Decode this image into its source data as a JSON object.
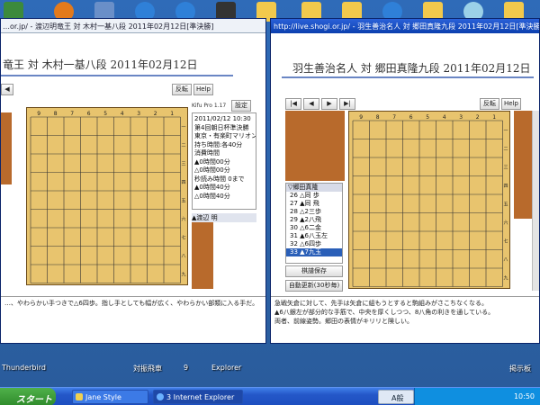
{
  "left_window": {
    "title": "…or.jp/ - 渡辺明竜王 対 木村一基八段 2011年02月12日[準決勝]",
    "heading": "竜王 対 木村一基八段  2011年02月12日",
    "buttons": {
      "reverse": "反転",
      "help": "Help",
      "settings": "設定"
    },
    "version": "Kifu Pro 1.17",
    "info_lines": [
      "2011/02/12 10:30",
      "第4回朝日杯準決勝",
      "東京・有楽町マリオン",
      "持ち時間:各40分",
      "消費時間",
      "▲0時間00分",
      "△0時間00分",
      "秒読み時間 0まで",
      "▲0時間40分",
      "△0時間40分"
    ],
    "player_gote": "▲渡辺 明",
    "comment": "…、やわらかい手つきで△6四歩。指し手としても幅が広く、やわらかい部類に入る手だ。"
  },
  "right_window": {
    "title": "http://live.shogi.or.jp/ - 羽生善治名人 対 郷田真隆九段 2011年02月12日[準決勝]",
    "heading": "羽生善治名人 対 郷田真隆九段  2011年02月12日",
    "buttons": {
      "reverse": "反転",
      "help": "Help"
    },
    "player": "▽郷田真隆",
    "moves": [
      "26 △同 歩",
      "27 ▲同 飛",
      "28 △2三歩",
      "29 ▲2八飛",
      "30 △6二金",
      "31 ▲6八玉左",
      "32 △6四歩",
      "33 ▲7九玉"
    ],
    "selected_move_index": 7,
    "save_button": "棋譜保存",
    "auto_update": "自動更新(30秒毎)",
    "comment_lines": [
      "急戦矢倉に対して、先手は矢倉に組もうとすると駒組みがさこちなくなる。",
      "▲6八銀左が部分的な手筋で、中央を厚くしつつ、8八角の利きを通している。",
      "両者、前線姿勢。郷田の表情がキリリと険しい。"
    ]
  },
  "board_ranks": [
    "一",
    "二",
    "三",
    "四",
    "五",
    "六",
    "七",
    "八",
    "九"
  ],
  "board_files": [
    "9",
    "8",
    "7",
    "6",
    "5",
    "4",
    "3",
    "2",
    "1"
  ],
  "desktop_labels": [
    "Thunderbird",
    "対振飛車",
    "9",
    "Explorer",
    "掲示板"
  ],
  "taskbar": {
    "start": "スタート",
    "tasks": [
      "Jane Style",
      "3 Internet Explorer"
    ],
    "tray_text": "A般",
    "clock": "10:50"
  },
  "colors": {
    "board": "#e8c46e",
    "komadai": "#b86a2c",
    "title_blue": "#0b3fae",
    "taskbar": "#2457c8"
  }
}
